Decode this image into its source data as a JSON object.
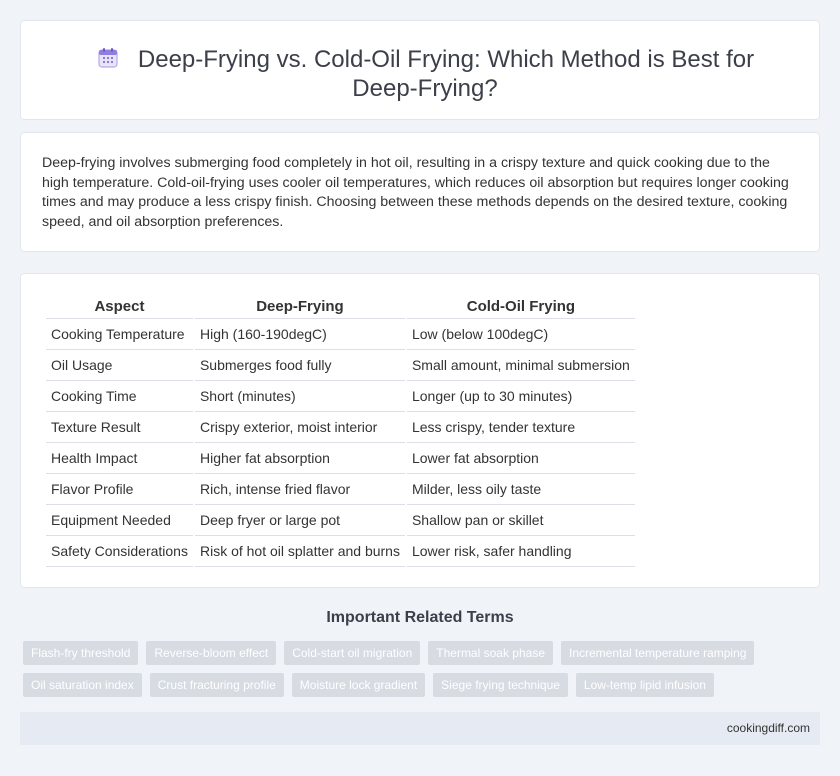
{
  "header": {
    "title": "Deep-Frying vs. Cold-Oil Frying: Which Method is Best for Deep-Frying?",
    "icon": "calendar-icon"
  },
  "intro": {
    "text": "Deep-frying involves submerging food completely in hot oil, resulting in a crispy texture and quick cooking due to the high temperature. Cold-oil-frying uses cooler oil temperatures, which reduces oil absorption but requires longer cooking times and may produce a less crispy finish. Choosing between these methods depends on the desired texture, cooking speed, and oil absorption preferences."
  },
  "table": {
    "headers": [
      "Aspect",
      "Deep-Frying",
      "Cold-Oil Frying"
    ],
    "rows": [
      [
        "Cooking Temperature",
        "High (160-190degC)",
        "Low (below 100degC)"
      ],
      [
        "Oil Usage",
        "Submerges food fully",
        "Small amount, minimal submersion"
      ],
      [
        "Cooking Time",
        "Short (minutes)",
        "Longer (up to 30 minutes)"
      ],
      [
        "Texture Result",
        "Crispy exterior, moist interior",
        "Less crispy, tender texture"
      ],
      [
        "Health Impact",
        "Higher fat absorption",
        "Lower fat absorption"
      ],
      [
        "Flavor Profile",
        "Rich, intense fried flavor",
        "Milder, less oily taste"
      ],
      [
        "Equipment Needed",
        "Deep fryer or large pot",
        "Shallow pan or skillet"
      ],
      [
        "Safety Considerations",
        "Risk of hot oil splatter and burns",
        "Lower risk, safer handling"
      ]
    ]
  },
  "related": {
    "title": "Important Related Terms",
    "rows": [
      [
        "Flash-fry threshold",
        "Reverse-bloom effect",
        "Cold-start oil migration",
        "Thermal soak phase",
        "Incremental temperature ramping"
      ],
      [
        "Oil saturation index",
        "Crust fracturing profile",
        "Moisture lock gradient",
        "Siege frying technique",
        "Low-temp lipid infusion"
      ]
    ]
  },
  "footer": {
    "site": "cookingdiff.com"
  }
}
